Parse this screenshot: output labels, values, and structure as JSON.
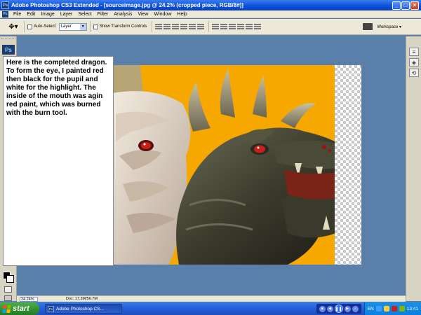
{
  "window": {
    "title": "Adobe Photoshop CS3 Extended - [sourceimage.jpg @ 24.2% (cropped piece, RGB/8#)]",
    "app_badge": "Ps"
  },
  "menu": [
    "File",
    "Edit",
    "Image",
    "Layer",
    "Select",
    "Filter",
    "Analysis",
    "View",
    "Window",
    "Help"
  ],
  "options": {
    "auto_select_label": "Auto-Select:",
    "auto_select_value": "Layer",
    "show_transform_label": "Show Transform Controls",
    "workspace_label": "Workspace ▾"
  },
  "toolbox": {
    "badge": "Ps"
  },
  "note": {
    "text": "Here is the completed dragon.  To form the eye, I painted red then black for the pupil and white for the highlight. The inside of the mouth was agin red paint, which was burned with the burn tool."
  },
  "status": {
    "zoom": "24.24%",
    "doc": "Doc: 17.3M/56.7M"
  },
  "taskbar": {
    "start": "start",
    "task_label": "Adobe Photoshop CS...",
    "task_badge": "Ps",
    "lang": "EN",
    "time": "13:41"
  },
  "colors": {
    "canvas_bg": "#f7a800",
    "workspace_bg": "#5a7faa",
    "dragon_dark": "#3a3a2a",
    "dragon_light": "#e8ddd0",
    "eye": "#c8201a"
  }
}
